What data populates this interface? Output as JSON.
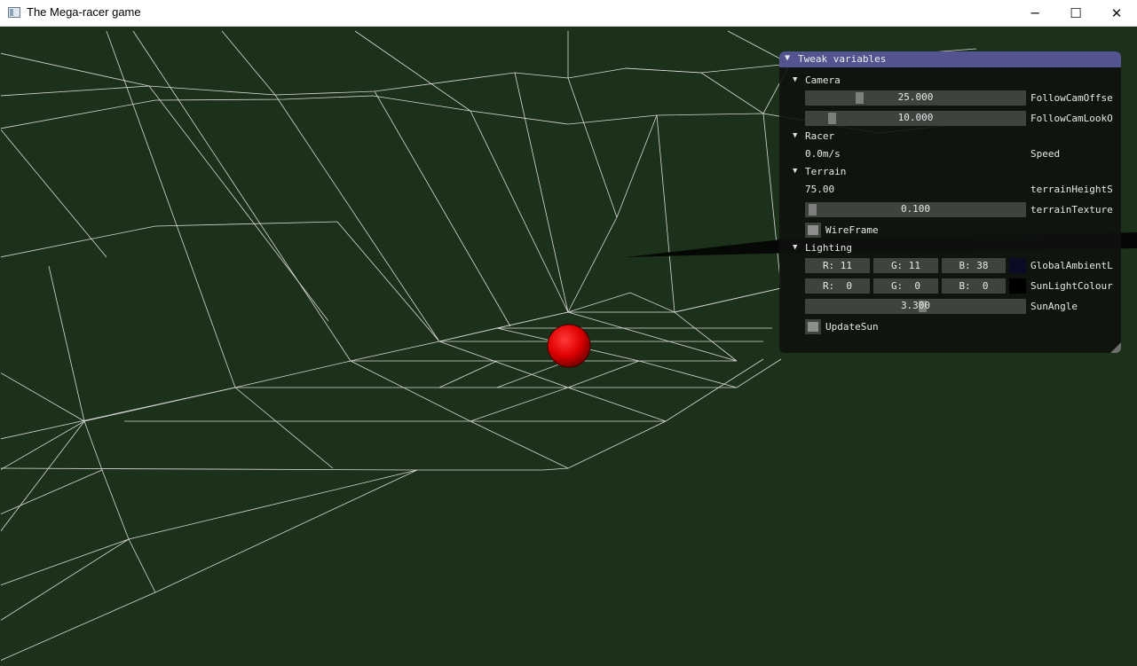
{
  "window": {
    "title": "The Mega-racer game",
    "minimize_glyph": "─",
    "maximize_glyph": "☐",
    "close_glyph": "✕"
  },
  "icons": {
    "app": "app-window-icon",
    "collapse": "triangle-down-icon",
    "resize": "resize-grip-icon"
  },
  "colors": {
    "terrain_bg": "#1b3119",
    "wireframe": "#d9d9d9",
    "racer_ball": "#e00000",
    "panel_header": "#53538f",
    "global_ambient_swatch": "#0b0b26",
    "sun_light_swatch": "#000000"
  },
  "panel": {
    "title": "Tweak variables",
    "collapse_glyph": "▼",
    "camera": {
      "label": "Camera",
      "follow_offset": {
        "value": "25.000",
        "label": "FollowCamOffse"
      },
      "follow_lookat": {
        "value": "10.000",
        "label": "FollowCamLookO"
      }
    },
    "racer": {
      "label": "Racer",
      "speed_value": "0.0m/s",
      "speed_label": "Speed"
    },
    "terrain": {
      "label": "Terrain",
      "height_value": "75.00",
      "height_label": "terrainHeightS",
      "texture": {
        "value": "0.100",
        "label": "terrainTexture"
      },
      "wireframe_label": "WireFrame"
    },
    "lighting": {
      "label": "Lighting",
      "global_ambient": {
        "r": "R: 11",
        "g": "G: 11",
        "b": "B: 38",
        "label": "GlobalAmbientL"
      },
      "sun_light": {
        "r": "R:  0",
        "g": "G:  0",
        "b": "B:  0",
        "label": "SunLightColour"
      },
      "sun_angle": {
        "value": "3.300",
        "label": "SunAngle"
      },
      "update_sun_label": "UpdateSun"
    }
  }
}
